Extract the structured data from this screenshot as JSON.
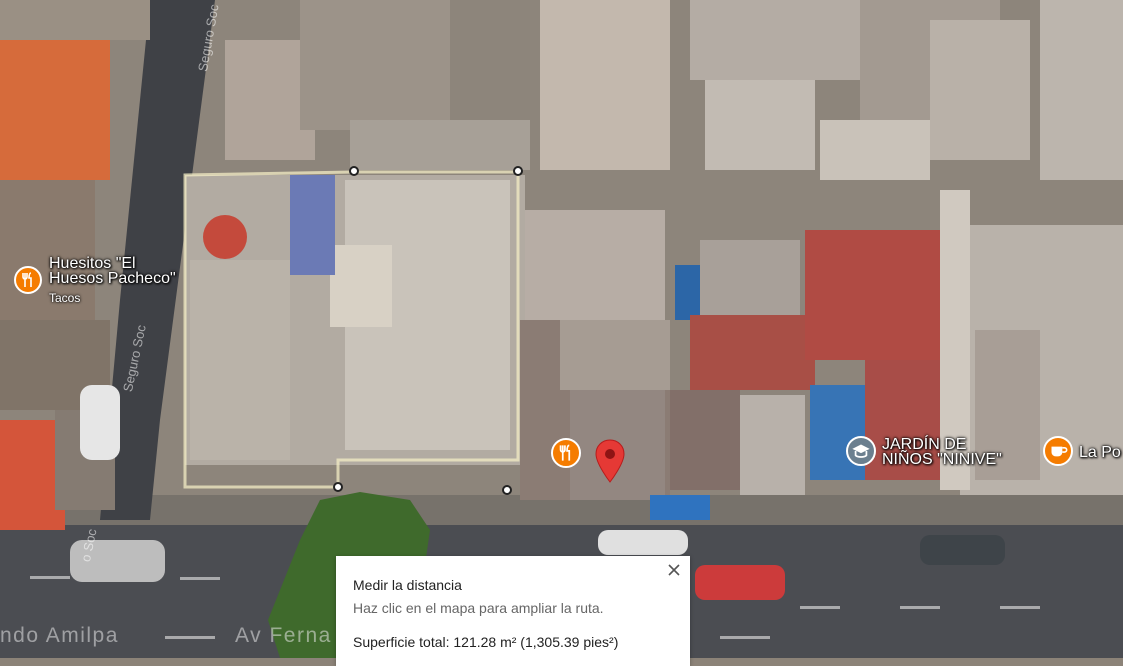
{
  "map": {
    "type": "satellite",
    "places": [
      {
        "name": "Huesitos \"El\nHuesos Pacheco\"",
        "category": "Tacos",
        "icon": "restaurant-icon"
      },
      {
        "name": "JARDÍN DE\nNIÑOS \"NINIVE\"",
        "icon": "school-icon"
      },
      {
        "name": "La Po",
        "icon": "cafe-icon"
      },
      {
        "icon": "restaurant-icon"
      }
    ],
    "streets": [
      "Seguro Soc",
      "Seguro Soc",
      "ndo Amilpa",
      "Av Ferna",
      "o Soc"
    ],
    "marker": {
      "icon": "location-pin-icon",
      "color": "#e53935"
    }
  },
  "measure": {
    "title": "Medir la distancia",
    "hint": "Haz clic en el mapa para ampliar la ruta.",
    "total": "Superficie total: 121.28 m² (1,305.39 pies²)",
    "close_icon": "close-icon"
  },
  "colors": {
    "poi_orange": "#f57c00",
    "school_gray": "#6b7f8f",
    "pin_red": "#e53935"
  }
}
